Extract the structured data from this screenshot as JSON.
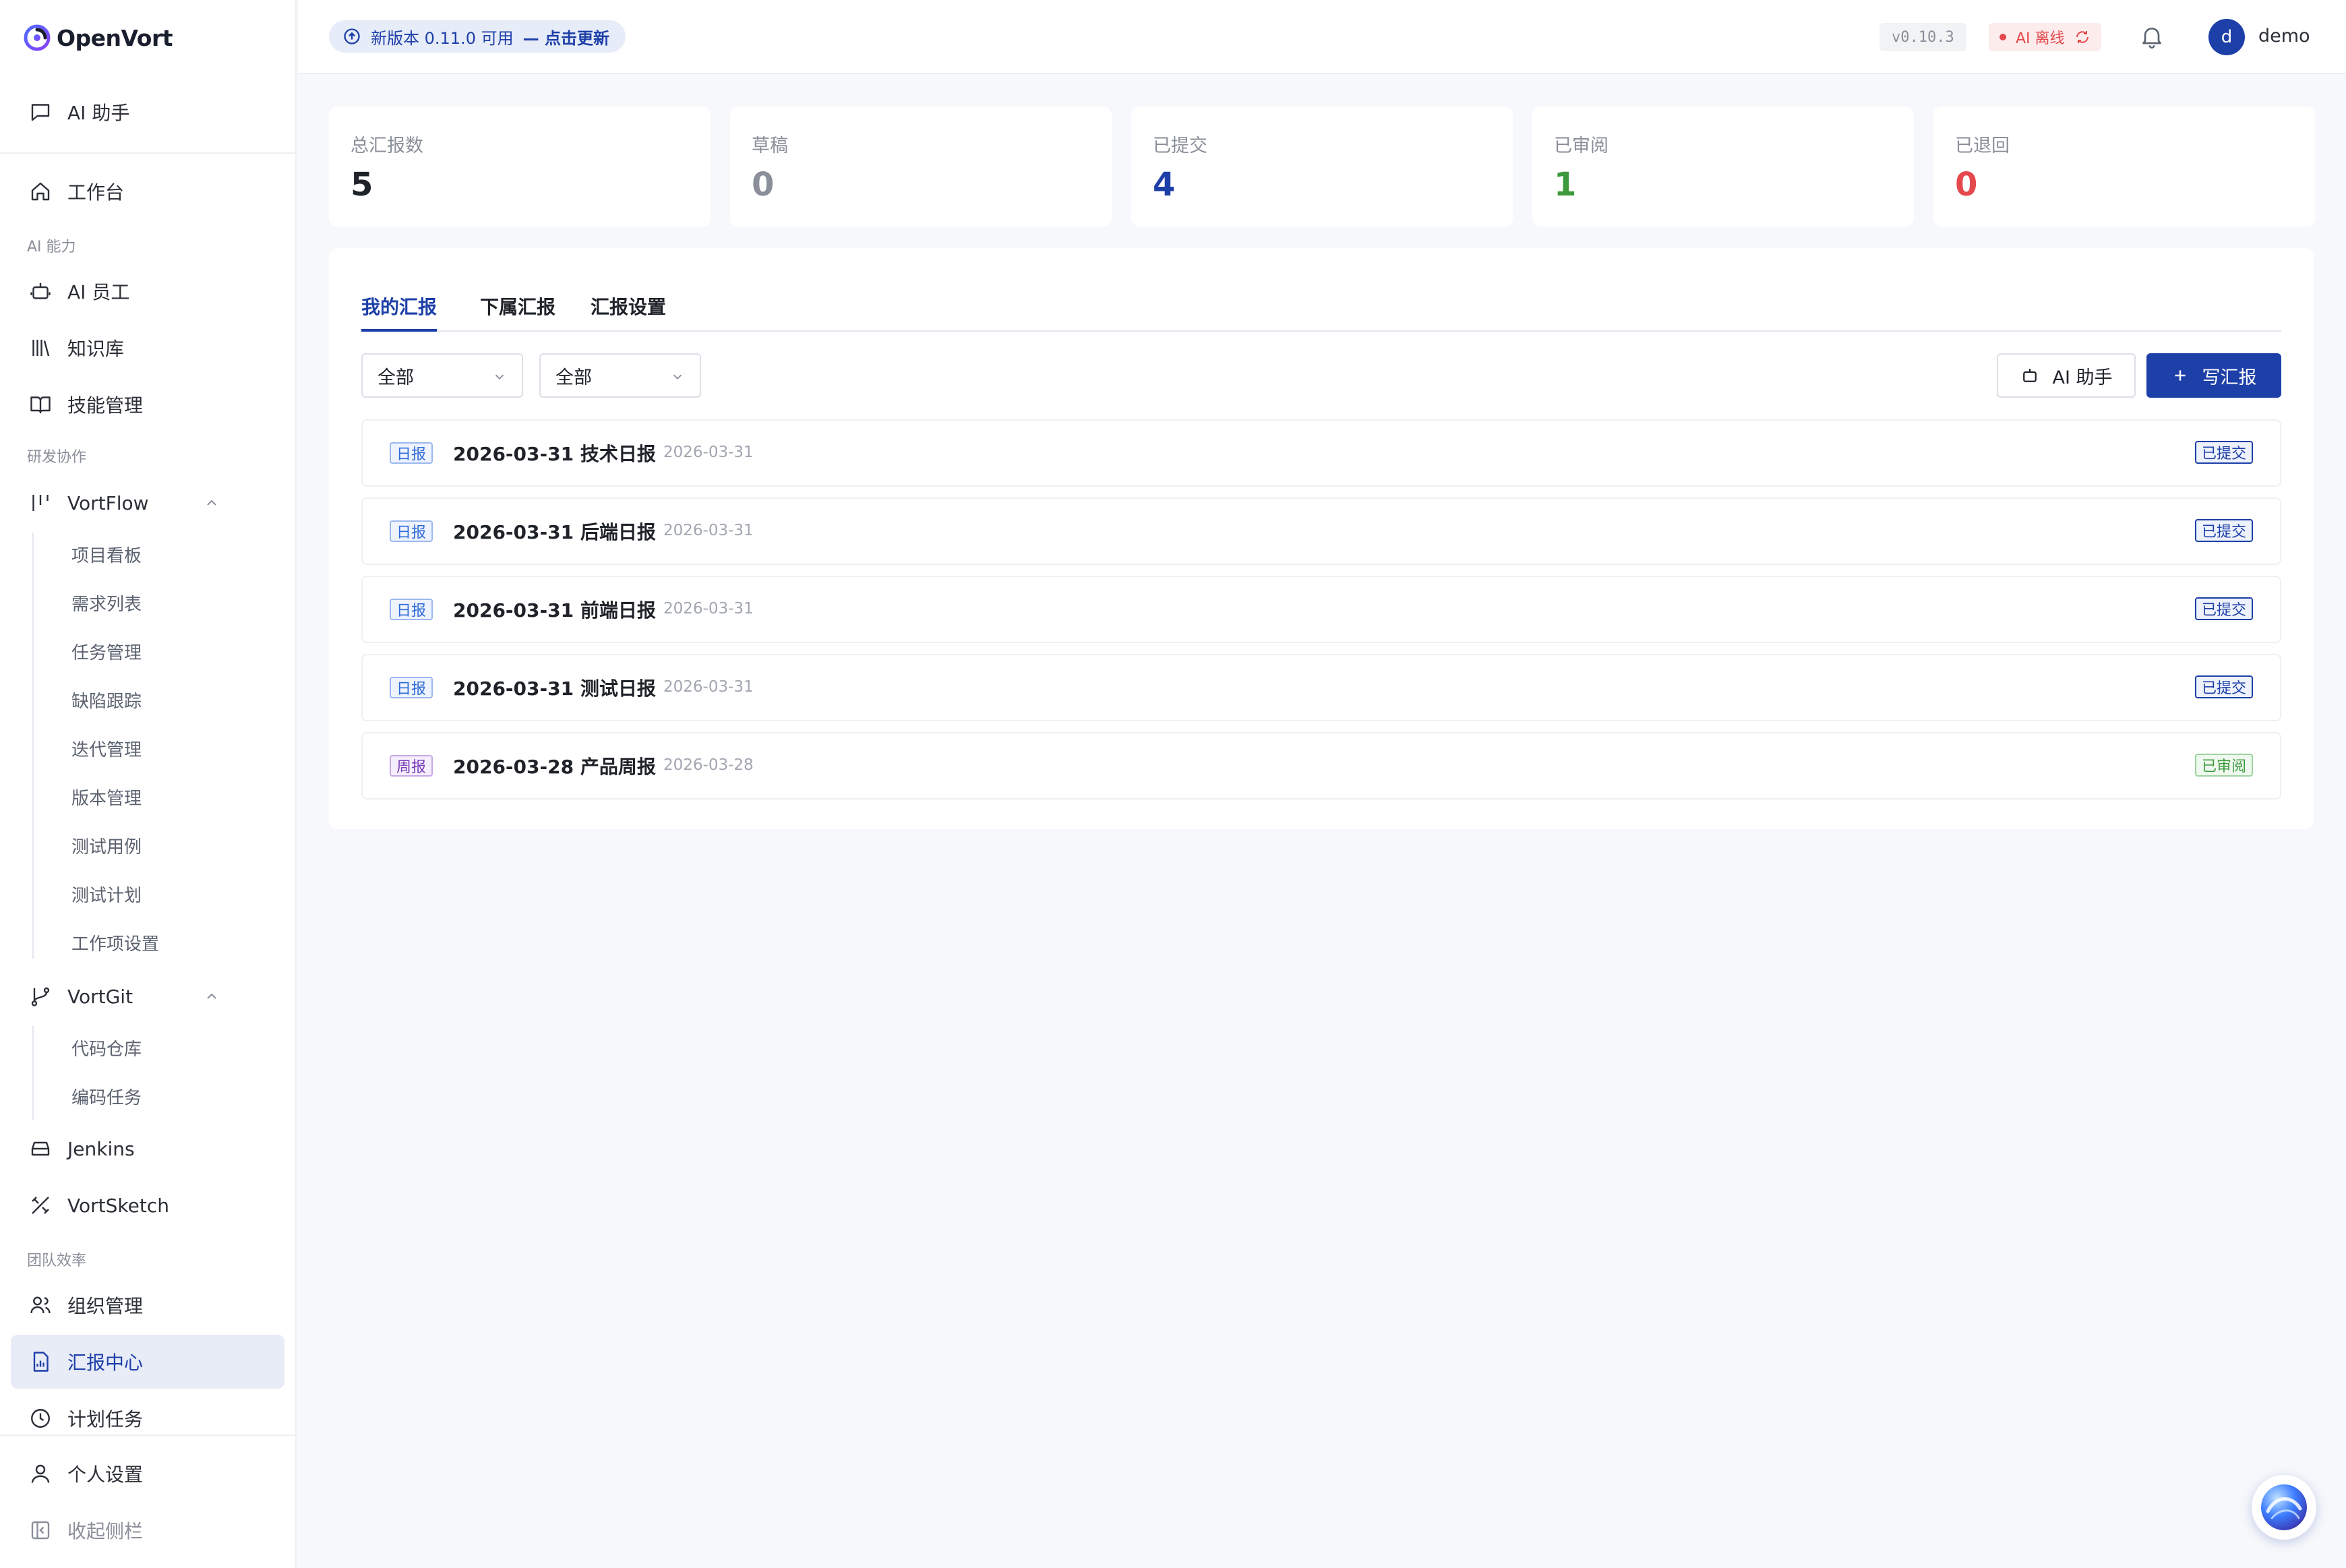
{
  "brand": {
    "name": "OpenVort"
  },
  "sidebar": {
    "ai_assistant": "AI 助手",
    "workbench": "工作台",
    "section_ai": "AI 能力",
    "ai_staff": "AI 员工",
    "knowledge": "知识库",
    "skills": "技能管理",
    "section_dev": "研发协作",
    "vortflow": "VortFlow",
    "vortflow_items": [
      "项目看板",
      "需求列表",
      "任务管理",
      "缺陷跟踪",
      "迭代管理",
      "版本管理",
      "测试用例",
      "测试计划",
      "工作项设置"
    ],
    "vortgit": "VortGit",
    "vortgit_items": [
      "代码仓库",
      "编码任务"
    ],
    "jenkins": "Jenkins",
    "vortsketch": "VortSketch",
    "section_team": "团队效率",
    "org": "组织管理",
    "report_center": "汇报中心",
    "scheduled": "计划任务",
    "personal": "个人设置",
    "collapse": "收起侧栏"
  },
  "topbar": {
    "update_text": "新版本 0.11.0 可用",
    "update_action": "— 点击更新",
    "version": "v0.10.3",
    "ai_status": "AI 离线",
    "avatar_letter": "d",
    "username": "demo"
  },
  "stats": [
    {
      "label": "总汇报数",
      "value": "5"
    },
    {
      "label": "草稿",
      "value": "0"
    },
    {
      "label": "已提交",
      "value": "4"
    },
    {
      "label": "已审阅",
      "value": "1"
    },
    {
      "label": "已退回",
      "value": "0"
    }
  ],
  "colors": {
    "total": "#1f2329",
    "draft": "#8a8f99",
    "submitted": "#1d3fa8",
    "reviewed": "#3c9a3c",
    "returned": "#e5484d"
  },
  "tabs": [
    "我的汇报",
    "下属汇报",
    "汇报设置"
  ],
  "filters": [
    "全部",
    "全部"
  ],
  "actions": {
    "ai_assistant": "AI 助手",
    "write": "写汇报"
  },
  "reports": [
    {
      "type": "日报",
      "title": "2026-03-31 技术日报",
      "date": "2026-03-31",
      "status": "已提交"
    },
    {
      "type": "日报",
      "title": "2026-03-31 后端日报",
      "date": "2026-03-31",
      "status": "已提交"
    },
    {
      "type": "日报",
      "title": "2026-03-31 前端日报",
      "date": "2026-03-31",
      "status": "已提交"
    },
    {
      "type": "日报",
      "title": "2026-03-31 测试日报",
      "date": "2026-03-31",
      "status": "已提交"
    },
    {
      "type": "周报",
      "title": "2026-03-28 产品周报",
      "date": "2026-03-28",
      "status": "已审阅"
    }
  ]
}
